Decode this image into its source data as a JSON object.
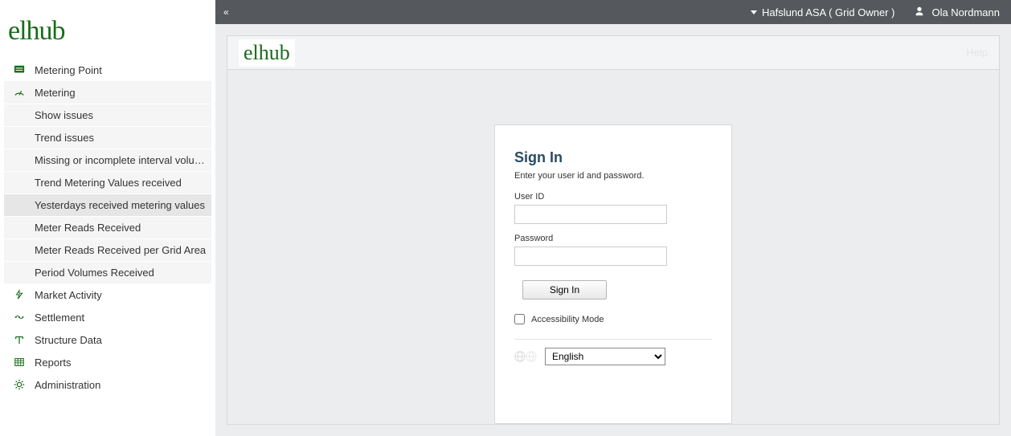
{
  "sidebar": {
    "logo": "elhub",
    "items": [
      {
        "label": "Metering Point"
      },
      {
        "label": "Metering"
      },
      {
        "label": "Market Activity"
      },
      {
        "label": "Settlement"
      },
      {
        "label": "Structure Data"
      },
      {
        "label": "Reports"
      },
      {
        "label": "Administration"
      }
    ],
    "metering_sub": [
      {
        "label": "Show issues"
      },
      {
        "label": "Trend issues"
      },
      {
        "label": "Missing or incomplete interval volu…"
      },
      {
        "label": "Trend Metering Values received"
      },
      {
        "label": "Yesterdays received metering values"
      },
      {
        "label": "Meter Reads Received"
      },
      {
        "label": "Meter Reads Received per Grid Area"
      },
      {
        "label": "Period Volumes Received"
      }
    ]
  },
  "topbar": {
    "org": "Hafslund ASA ( Grid Owner )",
    "user": "Ola Nordmann"
  },
  "panel": {
    "logo": "elhub",
    "help": "Help"
  },
  "signin": {
    "title": "Sign In",
    "subtitle": "Enter your user id and password.",
    "user_label": "User ID",
    "password_label": "Password",
    "button": "Sign In",
    "accessibility": "Accessibility Mode",
    "language": "English"
  }
}
